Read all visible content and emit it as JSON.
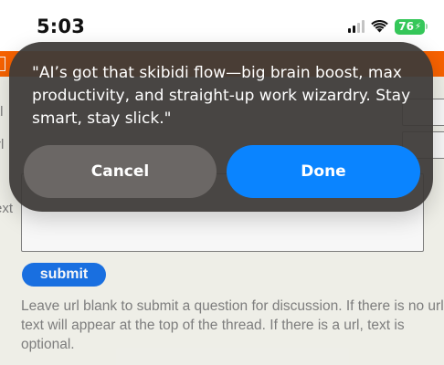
{
  "status_bar": {
    "time": "5:03",
    "battery": "76",
    "signal_bars": 2
  },
  "alert": {
    "message": "\"AI’s got that skibidi flow—big brain boost, max productivity, and straight-up work wizardry. Stay smart, stay slick.\"",
    "cancel_label": "Cancel",
    "done_label": "Done"
  },
  "page": {
    "url_label_fragment": "rl",
    "text_label_fragment": "ext",
    "title_label_fragment": "tl",
    "submit_label": "submit",
    "help_text": "Leave url blank to submit a question for discussion. If there is no url, text will appear at the top of the thread. If there is a url, text is optional."
  },
  "colors": {
    "hn_orange": "#ff6600",
    "ios_blue": "#0a84ff",
    "battery_green": "#35c759"
  }
}
